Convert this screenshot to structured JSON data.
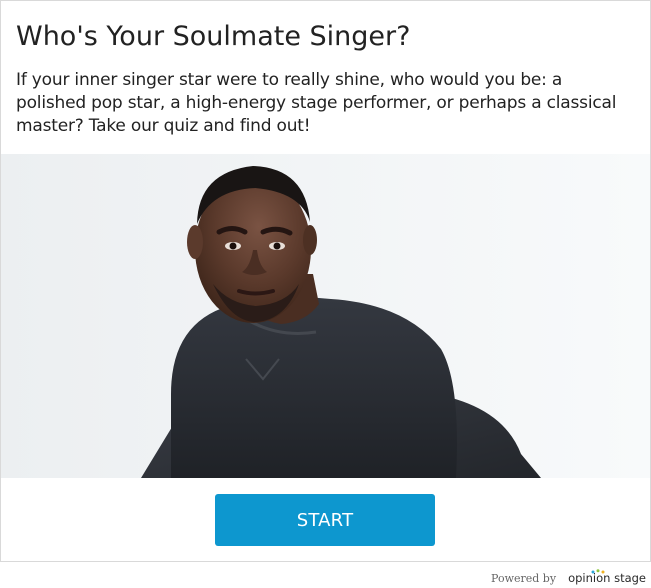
{
  "quiz": {
    "title": "Who's Your Soulmate Singer?",
    "description": "If your inner singer star were to really shine, who would you be: a polished pop star, a high-energy stage performer, or perhaps a classical master? Take our quiz and find out!",
    "start_label": "START",
    "accent_color": "#0d97cf",
    "cover_image": "portrait-photo"
  },
  "footer": {
    "powered_label": "Powered by",
    "brand_name": "opinion stage",
    "brand_dot_colors": [
      "#2ea7d8",
      "#8cc63f",
      "#f0b323"
    ]
  }
}
